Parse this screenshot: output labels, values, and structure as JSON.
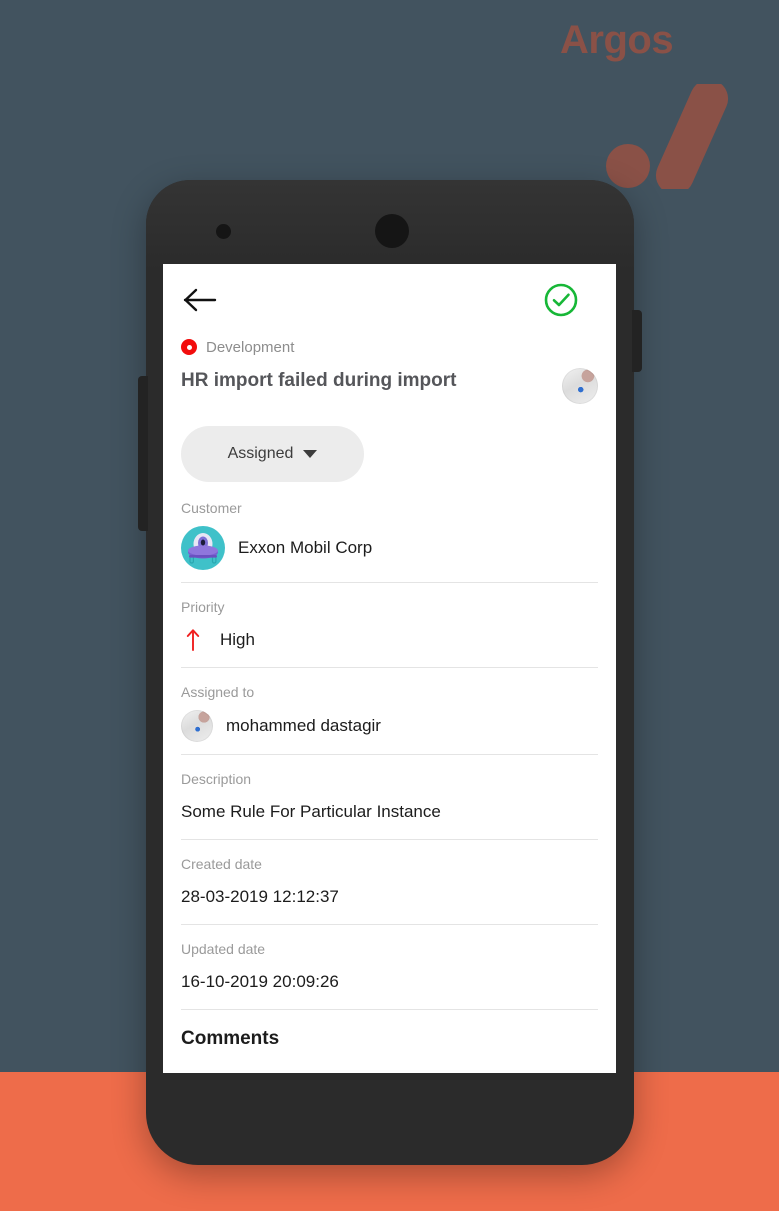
{
  "brand": {
    "name": "Argos",
    "color": "#8a5147"
  },
  "colors": {
    "backdrop": "#42535f",
    "accent_band": "#ee6c4a",
    "phone_body": "#2b2b2b",
    "category_dot": "#f20d0d",
    "confirm_green": "#17b737",
    "priority_red": "#f02020",
    "pill_background": "#ececec",
    "customer_avatar": "#3fc1c9"
  },
  "appbar": {
    "back_icon": "arrow-left-icon",
    "confirm_icon": "check-circle-icon"
  },
  "ticket": {
    "category": "Development",
    "title": "HR import failed during import",
    "status": "Assigned",
    "status_caret_icon": "chevron-down-icon",
    "reporter_avatar_icon": "user-avatar-photo"
  },
  "fields": [
    {
      "label": "Customer",
      "value": "Exxon Mobil Corp",
      "icon": "customer-ufo-avatar-icon"
    },
    {
      "label": "Priority",
      "value": "High",
      "icon": "arrow-up-icon"
    },
    {
      "label": "Assigned to",
      "value": "mohammed dastagir",
      "icon": "user-avatar-photo"
    },
    {
      "label": "Description",
      "value": "Some Rule For Particular Instance",
      "icon": ""
    },
    {
      "label": "Created date",
      "value": "28-03-2019 12:12:37",
      "icon": ""
    },
    {
      "label": "Updated date",
      "value": "16-10-2019 20:09:26",
      "icon": ""
    }
  ],
  "comments": {
    "heading": "Comments"
  }
}
